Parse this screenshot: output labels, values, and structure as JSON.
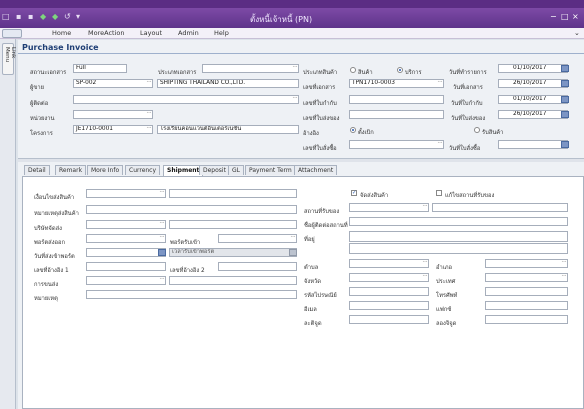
{
  "window": {
    "title": "ตั้งหนี้เจ้าหนี้ (PN)",
    "min_glyph": "−",
    "max_glyph": "□",
    "close_glyph": "×",
    "quick_access": [
      "□",
      "▪",
      "▪",
      "◆",
      "◆",
      "↺",
      "▾"
    ]
  },
  "ribbon": {
    "menus": [
      "Home",
      "MoreAction",
      "Layout",
      "Admin",
      "Help"
    ],
    "collapse_glyph": "⌄"
  },
  "sidebar": {
    "tab_label": "Link Menu"
  },
  "page": {
    "title": "Purchase Invoice"
  },
  "header": {
    "doc_status_label": "สถานะเอกสาร",
    "doc_status_value": "Full",
    "doc_type_label": "ประเภทเอกสาร",
    "doc_type_value": "",
    "vendor_label": "ผู้ขาย",
    "vendor_code": "SP-002",
    "vendor_name": "SHIPTING THAILAND CO.,LTD.",
    "contact_label": "ผู้ติดต่อ",
    "contact_value": "",
    "agency_label": "หน่วยงาน",
    "agency_value": "",
    "agency_extra": "",
    "project_label": "โครงการ",
    "project_code": "JE1710-0001",
    "project_name": "โรงเรียนคอนแวนต์อินเตอร์เนชั่น",
    "product_type_label": "ประเภทสินค้า",
    "product_type_options": [
      "สินค้า",
      "บริการ"
    ],
    "product_type_selected": "บริการ",
    "doc_no_label": "เลขที่เอกสาร",
    "doc_no_value": "TPN1710-0003",
    "tax_inv_label": "เลขที่ใบกำกับ",
    "tax_inv_value": "",
    "delivery_label": "เลขที่ใบส่งของ",
    "delivery_value": "",
    "assign_label": "อ้างอิง",
    "assign_options": [
      "ตั้งเบิก",
      "รับสินค้า"
    ],
    "assign_selected": "ตั้งเบิก",
    "po_label": "เลขที่ใบสั่งซื้อ",
    "po_value": "",
    "txn_date_label": "วันที่ทำรายการ",
    "txn_date_value": "01/10/2017",
    "doc_date_label": "วันที่เอกสาร",
    "doc_date_value": "26/10/2017",
    "tax_date_label": "วันที่ใบกำกับ",
    "tax_date_value": "01/10/2017",
    "delivery_date_label": "วันที่ใบส่งของ",
    "delivery_date_value": "26/10/2017",
    "po_date_label": "วันที่ใบสั่งซื้อ",
    "po_date_value": ""
  },
  "tabs": {
    "items": [
      "Detail",
      "Remark",
      "More Info",
      "Currency",
      "Shipment",
      "Deposit",
      "GL",
      "Payment Term",
      "Attachment"
    ],
    "active": "Shipment"
  },
  "shipment": {
    "ship_by_label": "เงื่อนไขส่งสินค้า",
    "ship_by_value": "",
    "ship_note_label": "หมายเหตุส่งสินค้า",
    "ship_note_value": "",
    "carrier_label": "บริษัทจัดส่ง",
    "carrier_value": "",
    "port_from_label": "พอร์ตส่งออก",
    "port_from_value": "",
    "port_to_label": "พอร์ตรับเข้า",
    "port_to_value": "",
    "ship_date_label": "วันที่ส่งเข้าพอร์ต",
    "ship_date_value": "",
    "arrive_label": "เวลารับเข้าพอร์ต",
    "arrive_value": "",
    "ref1_label": "เลขที่อ้างอิง 1",
    "ref1_value": "",
    "ref2_label": "เลขที่อ้างอิง 2",
    "ref2_value": "",
    "transport_label": "การขนส่ง",
    "transport_value": "",
    "remark_label": "หมายเหตุ",
    "remark_value": "",
    "chk_ship_label": "จัดส่งสินค้า",
    "chk_ship_checked": true,
    "chk_edit_label": "แก้ไขสถานที่รับของ",
    "chk_edit_checked": false,
    "place_label": "สถานที่รับของ",
    "place_code": "",
    "place_name": "",
    "contact_addr_label": "ชื่อผู้ติดต่อสถานที่",
    "contact_addr_value": "",
    "address_label": "ที่อยู่",
    "address_value": "",
    "district_label": "ตำบล",
    "district_value": "",
    "amphur_label": "อำเภอ",
    "amphur_value": "",
    "province_label": "จังหวัด",
    "province_value": "",
    "country_label": "ประเทศ",
    "country_value": "",
    "zip_label": "รหัสไปรษณีย์",
    "zip_value": "",
    "phone_label": "โทรศัพท์",
    "phone_value": "",
    "email_label": "อีเมล",
    "email_value": "",
    "fax_label": "แฟกซ์",
    "fax_value": "",
    "lat_label": "ละติจูด",
    "lat_value": "",
    "long_label": "ลองจิจูด",
    "long_value": ""
  },
  "colors": {
    "titlebar": "#6b3c97",
    "accent": "#1f3f75",
    "field_border": "#a6aebb"
  }
}
